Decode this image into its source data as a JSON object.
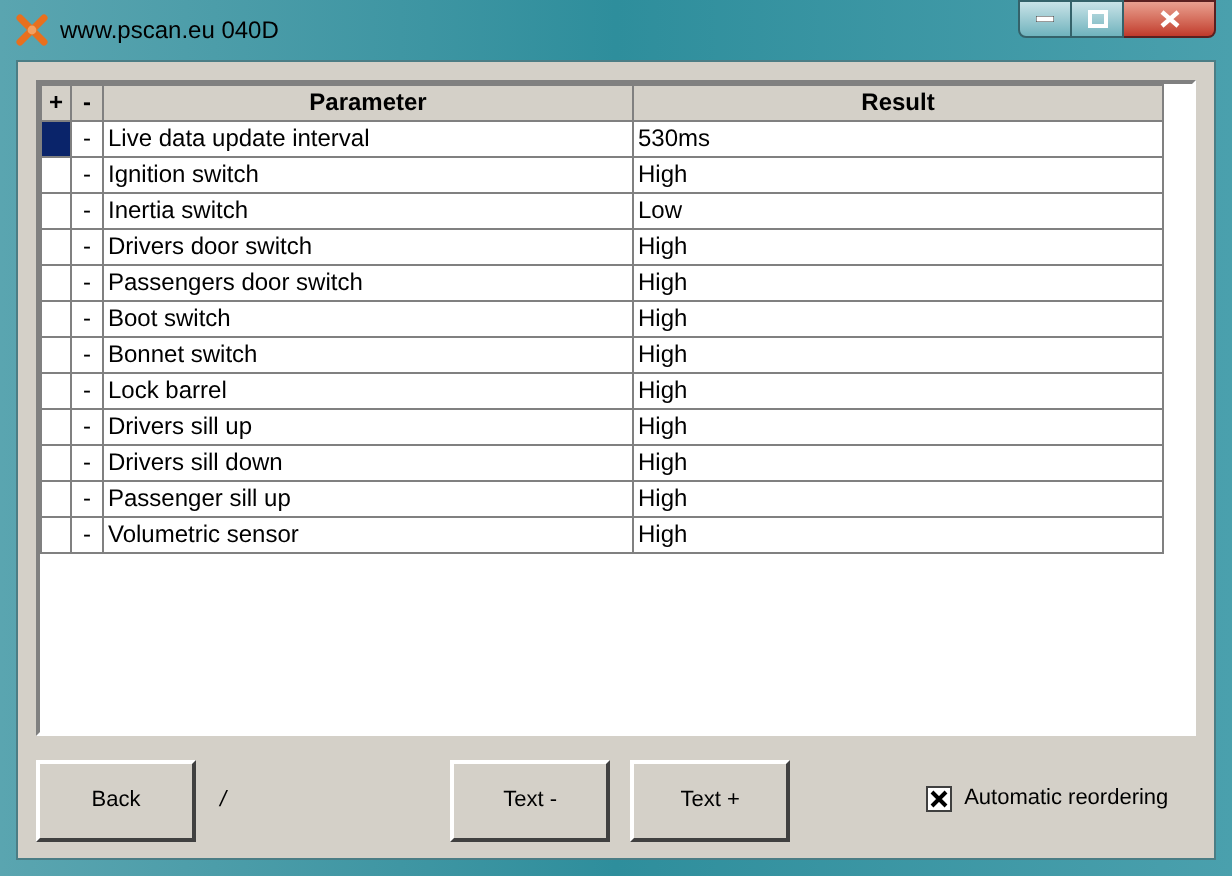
{
  "window": {
    "title": "www.pscan.eu 040D"
  },
  "table": {
    "columns": [
      "+",
      "-",
      "Parameter",
      "Result"
    ],
    "rows": [
      {
        "marker": "-",
        "parameter": "Live data update interval",
        "result": "530ms",
        "selected": true
      },
      {
        "marker": "-",
        "parameter": "Ignition switch",
        "result": "High",
        "selected": false
      },
      {
        "marker": "-",
        "parameter": "Inertia switch",
        "result": "Low",
        "selected": false
      },
      {
        "marker": "-",
        "parameter": "Drivers door switch",
        "result": "High",
        "selected": false
      },
      {
        "marker": "-",
        "parameter": "Passengers door switch",
        "result": "High",
        "selected": false
      },
      {
        "marker": "-",
        "parameter": "Boot switch",
        "result": "High",
        "selected": false
      },
      {
        "marker": "-",
        "parameter": "Bonnet switch",
        "result": "High",
        "selected": false
      },
      {
        "marker": "-",
        "parameter": "Lock barrel",
        "result": "High",
        "selected": false
      },
      {
        "marker": "-",
        "parameter": "Drivers sill up",
        "result": "High",
        "selected": false
      },
      {
        "marker": "-",
        "parameter": "Drivers sill down",
        "result": "High",
        "selected": false
      },
      {
        "marker": "-",
        "parameter": "Passenger sill up",
        "result": "High",
        "selected": false
      },
      {
        "marker": "-",
        "parameter": "Volumetric sensor",
        "result": "High",
        "selected": false
      }
    ]
  },
  "buttons": {
    "back": "Back",
    "separator": "/",
    "text_minus": "Text -",
    "text_plus": "Text +"
  },
  "checkbox": {
    "label": "Automatic reordering",
    "checked": true
  }
}
